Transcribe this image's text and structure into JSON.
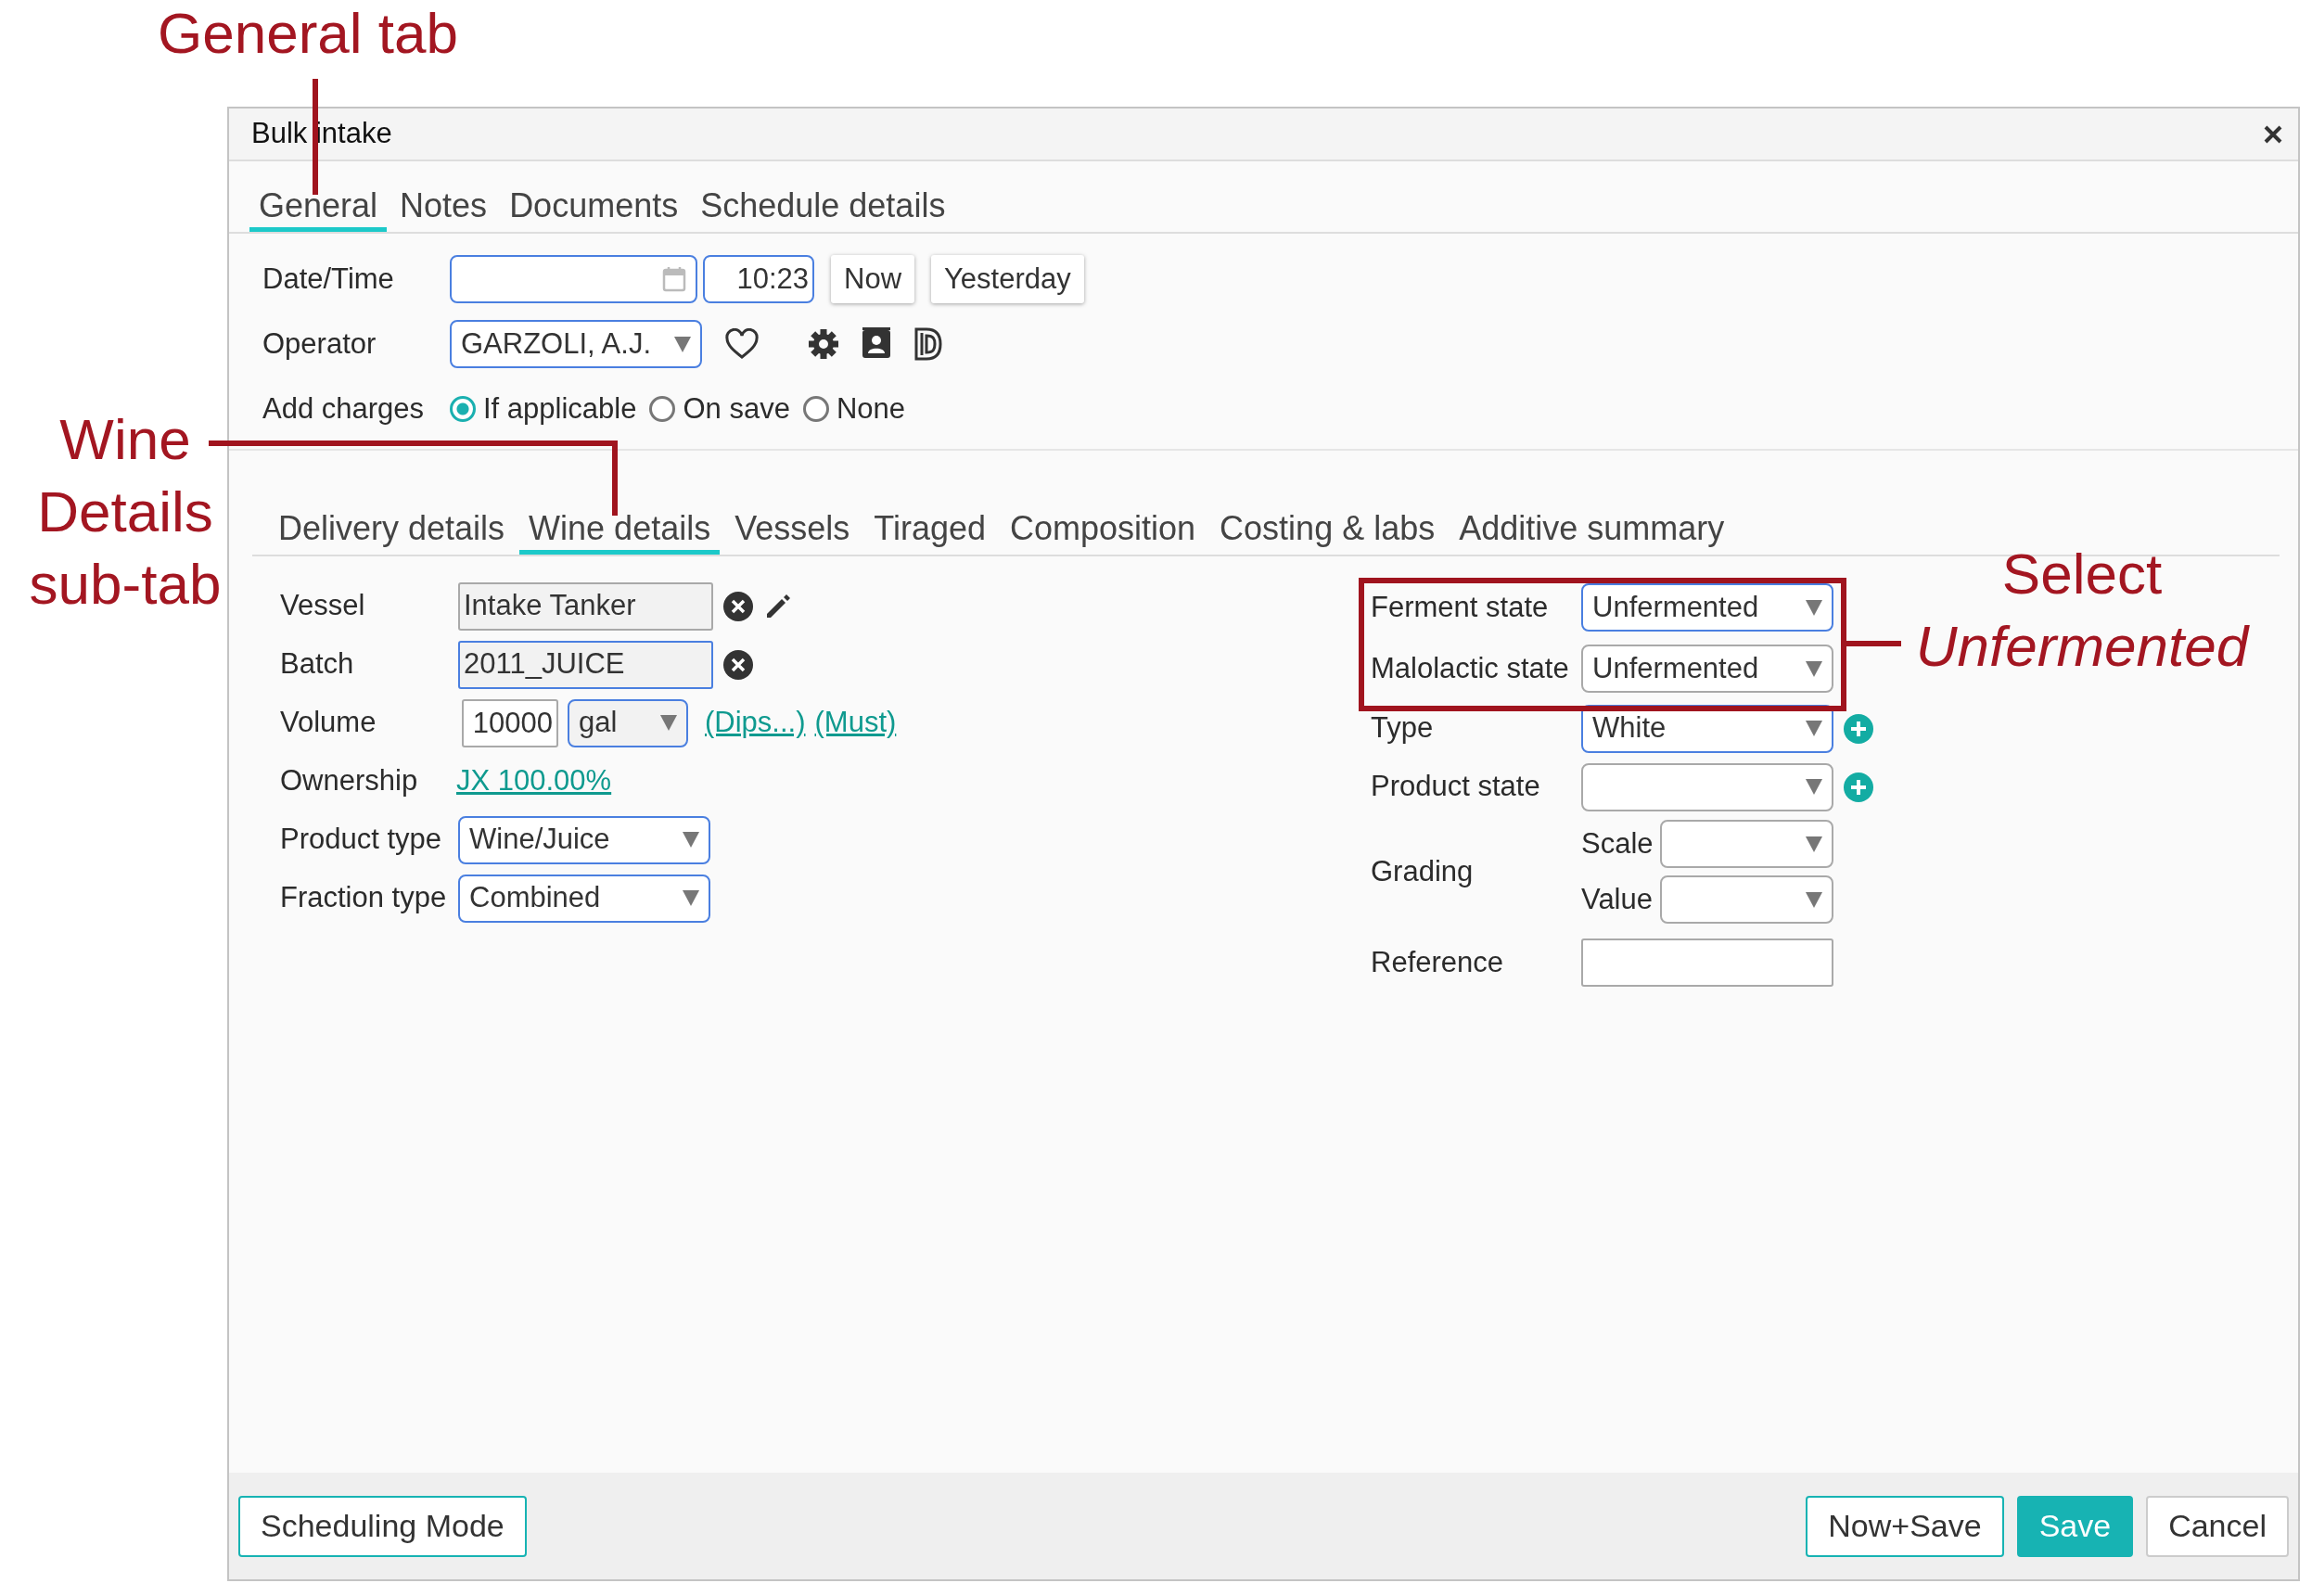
{
  "dialog": {
    "title": "Bulk intake"
  },
  "tabs": [
    {
      "label": "General",
      "selected": true
    },
    {
      "label": "Notes",
      "selected": false
    },
    {
      "label": "Documents",
      "selected": false
    },
    {
      "label": "Schedule details",
      "selected": false
    }
  ],
  "general": {
    "date_time": {
      "label": "Date/Time",
      "time": "10:23",
      "buttons": [
        "Now",
        "Yesterday"
      ]
    },
    "operator": {
      "label": "Operator",
      "value": "GARZOLI, A.J."
    },
    "add_charges": {
      "label": "Add charges",
      "options": [
        {
          "label": "If applicable",
          "selected": true
        },
        {
          "label": "On save",
          "selected": false
        },
        {
          "label": "None",
          "selected": false
        }
      ]
    }
  },
  "sub_tabs": [
    {
      "label": "Delivery details",
      "selected": false
    },
    {
      "label": "Wine details",
      "selected": true
    },
    {
      "label": "Vessels",
      "selected": false
    },
    {
      "label": "Tiraged",
      "selected": false
    },
    {
      "label": "Composition",
      "selected": false
    },
    {
      "label": "Costing & labs",
      "selected": false
    },
    {
      "label": "Additive summary",
      "selected": false
    }
  ],
  "wine_details": {
    "left": [
      {
        "kind": "readonly",
        "label": "Vessel",
        "value": "Intake Tanker",
        "highlighted": false,
        "clear": true,
        "edit": true
      },
      {
        "kind": "readonly",
        "label": "Batch",
        "value": "2011_JUICE",
        "highlighted": true,
        "clear": true,
        "edit": false
      },
      {
        "kind": "volume",
        "label": "Volume",
        "amount": "10000",
        "unit": {
          "value": "gal",
          "highlighted": true
        },
        "links": [
          "(Dips...)",
          "(Must)"
        ]
      },
      {
        "kind": "link",
        "label": "Ownership",
        "link": "JX 100.00%"
      },
      {
        "kind": "select",
        "label": "Product type",
        "value": "Wine/Juice",
        "highlighted": true
      },
      {
        "kind": "select",
        "label": "Fraction type",
        "value": "Combined",
        "highlighted": true
      }
    ],
    "right": [
      {
        "kind": "select",
        "label": "Ferment state",
        "value": "Unfermented",
        "highlighted": true,
        "add": false
      },
      {
        "kind": "select",
        "label": "Malolactic state",
        "value": "Unfermented",
        "highlighted": false,
        "add": false
      },
      {
        "kind": "select",
        "label": "Type",
        "value": "White",
        "highlighted": true,
        "add": true
      },
      {
        "kind": "select",
        "label": "Product state",
        "highlighted": false,
        "add": true
      },
      {
        "kind": "grading",
        "label": "Grading",
        "parts": [
          {
            "label": "Scale"
          },
          {
            "label": "Value"
          }
        ]
      },
      {
        "kind": "text",
        "label": "Reference"
      }
    ]
  },
  "footer": {
    "left": [
      {
        "label": "Scheduling Mode",
        "kind": "outline"
      }
    ],
    "right": [
      {
        "label": "Now+Save",
        "kind": "outline"
      },
      {
        "label": "Save",
        "kind": "primary"
      },
      {
        "label": "Cancel",
        "kind": "plain"
      }
    ]
  },
  "annotations": [
    {
      "kind": "callout",
      "lines": [
        "General tab"
      ]
    },
    {
      "kind": "callout",
      "lines": [
        "Wine",
        "Details",
        "sub-tab"
      ]
    },
    {
      "kind": "callout",
      "lines": [
        "Select",
        "*Unfermented*"
      ]
    },
    {
      "kind": "frame"
    }
  ]
}
